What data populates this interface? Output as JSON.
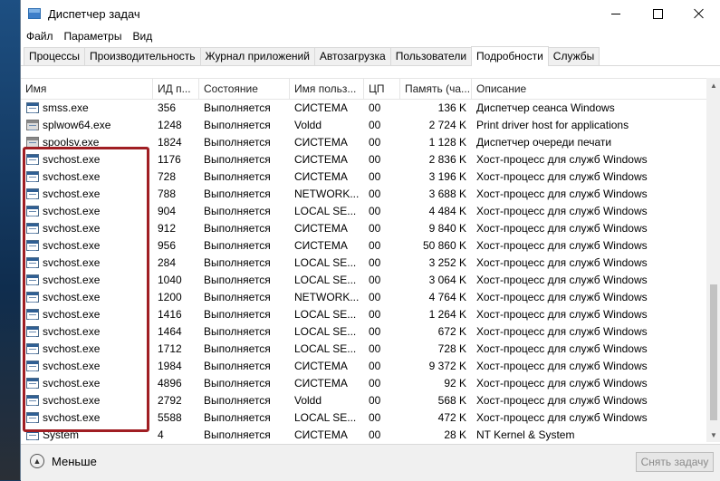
{
  "window": {
    "title": "Диспетчер задач"
  },
  "menu": [
    "Файл",
    "Параметры",
    "Вид"
  ],
  "tabs": [
    {
      "label": "Процессы",
      "active": false
    },
    {
      "label": "Производительность",
      "active": false
    },
    {
      "label": "Журнал приложений",
      "active": false
    },
    {
      "label": "Автозагрузка",
      "active": false
    },
    {
      "label": "Пользователи",
      "active": false
    },
    {
      "label": "Подробности",
      "active": true
    },
    {
      "label": "Службы",
      "active": false
    }
  ],
  "table": {
    "columns": [
      "Имя",
      "ИД п...",
      "Состояние",
      "Имя польз...",
      "ЦП",
      "Память (ча...",
      "Описание"
    ],
    "rows": [
      {
        "name": "smss.exe",
        "pid": "356",
        "state": "Выполняется",
        "user": "СИСТЕМА",
        "cpu": "00",
        "mem": "136 K",
        "desc": "Диспетчер сеанса  Windows",
        "icon": "process-icon"
      },
      {
        "name": "splwow64.exe",
        "pid": "1248",
        "state": "Выполняется",
        "user": "Voldd",
        "cpu": "00",
        "mem": "2 724 K",
        "desc": "Print driver host for applications",
        "icon": "printer-icon"
      },
      {
        "name": "spoolsv.exe",
        "pid": "1824",
        "state": "Выполняется",
        "user": "СИСТЕМА",
        "cpu": "00",
        "mem": "1 128 K",
        "desc": "Диспетчер очереди печати",
        "icon": "printer-icon"
      },
      {
        "name": "svchost.exe",
        "pid": "1176",
        "state": "Выполняется",
        "user": "СИСТЕМА",
        "cpu": "00",
        "mem": "2 836 K",
        "desc": "Хост-процесс для служб Windows",
        "icon": "process-icon"
      },
      {
        "name": "svchost.exe",
        "pid": "728",
        "state": "Выполняется",
        "user": "СИСТЕМА",
        "cpu": "00",
        "mem": "3 196 K",
        "desc": "Хост-процесс для служб Windows",
        "icon": "process-icon"
      },
      {
        "name": "svchost.exe",
        "pid": "788",
        "state": "Выполняется",
        "user": "NETWORK...",
        "cpu": "00",
        "mem": "3 688 K",
        "desc": "Хост-процесс для служб Windows",
        "icon": "process-icon"
      },
      {
        "name": "svchost.exe",
        "pid": "904",
        "state": "Выполняется",
        "user": "LOCAL SE...",
        "cpu": "00",
        "mem": "4 484 K",
        "desc": "Хост-процесс для служб Windows",
        "icon": "process-icon"
      },
      {
        "name": "svchost.exe",
        "pid": "912",
        "state": "Выполняется",
        "user": "СИСТЕМА",
        "cpu": "00",
        "mem": "9 840 K",
        "desc": "Хост-процесс для служб Windows",
        "icon": "process-icon"
      },
      {
        "name": "svchost.exe",
        "pid": "956",
        "state": "Выполняется",
        "user": "СИСТЕМА",
        "cpu": "00",
        "mem": "50 860 K",
        "desc": "Хост-процесс для служб Windows",
        "icon": "process-icon"
      },
      {
        "name": "svchost.exe",
        "pid": "284",
        "state": "Выполняется",
        "user": "LOCAL SE...",
        "cpu": "00",
        "mem": "3 252 K",
        "desc": "Хост-процесс для служб Windows",
        "icon": "process-icon"
      },
      {
        "name": "svchost.exe",
        "pid": "1040",
        "state": "Выполняется",
        "user": "LOCAL SE...",
        "cpu": "00",
        "mem": "3 064 K",
        "desc": "Хост-процесс для служб Windows",
        "icon": "process-icon"
      },
      {
        "name": "svchost.exe",
        "pid": "1200",
        "state": "Выполняется",
        "user": "NETWORK...",
        "cpu": "00",
        "mem": "4 764 K",
        "desc": "Хост-процесс для служб Windows",
        "icon": "process-icon"
      },
      {
        "name": "svchost.exe",
        "pid": "1416",
        "state": "Выполняется",
        "user": "LOCAL SE...",
        "cpu": "00",
        "mem": "1 264 K",
        "desc": "Хост-процесс для служб Windows",
        "icon": "process-icon"
      },
      {
        "name": "svchost.exe",
        "pid": "1464",
        "state": "Выполняется",
        "user": "LOCAL SE...",
        "cpu": "00",
        "mem": "672 K",
        "desc": "Хост-процесс для служб Windows",
        "icon": "process-icon"
      },
      {
        "name": "svchost.exe",
        "pid": "1712",
        "state": "Выполняется",
        "user": "LOCAL SE...",
        "cpu": "00",
        "mem": "728 K",
        "desc": "Хост-процесс для служб Windows",
        "icon": "process-icon"
      },
      {
        "name": "svchost.exe",
        "pid": "1984",
        "state": "Выполняется",
        "user": "СИСТЕМА",
        "cpu": "00",
        "mem": "9 372 K",
        "desc": "Хост-процесс для служб Windows",
        "icon": "process-icon"
      },
      {
        "name": "svchost.exe",
        "pid": "4896",
        "state": "Выполняется",
        "user": "СИСТЕМА",
        "cpu": "00",
        "mem": "92 K",
        "desc": "Хост-процесс для служб Windows",
        "icon": "process-icon"
      },
      {
        "name": "svchost.exe",
        "pid": "2792",
        "state": "Выполняется",
        "user": "Voldd",
        "cpu": "00",
        "mem": "568 K",
        "desc": "Хост-процесс для служб Windows",
        "icon": "process-icon"
      },
      {
        "name": "svchost.exe",
        "pid": "5588",
        "state": "Выполняется",
        "user": "LOCAL SE...",
        "cpu": "00",
        "mem": "472 K",
        "desc": "Хост-процесс для служб Windows",
        "icon": "process-icon"
      },
      {
        "name": "System",
        "pid": "4",
        "state": "Выполняется",
        "user": "СИСТЕМА",
        "cpu": "00",
        "mem": "28 K",
        "desc": "NT Kernel & System",
        "icon": "process-icon"
      }
    ]
  },
  "footer": {
    "less_label": "Меньше",
    "end_task_label": "Снять задачу"
  },
  "colors": {
    "highlight": "#a01e23",
    "window_bg": "#ffffff",
    "footer_bg": "#f0f0f0"
  }
}
